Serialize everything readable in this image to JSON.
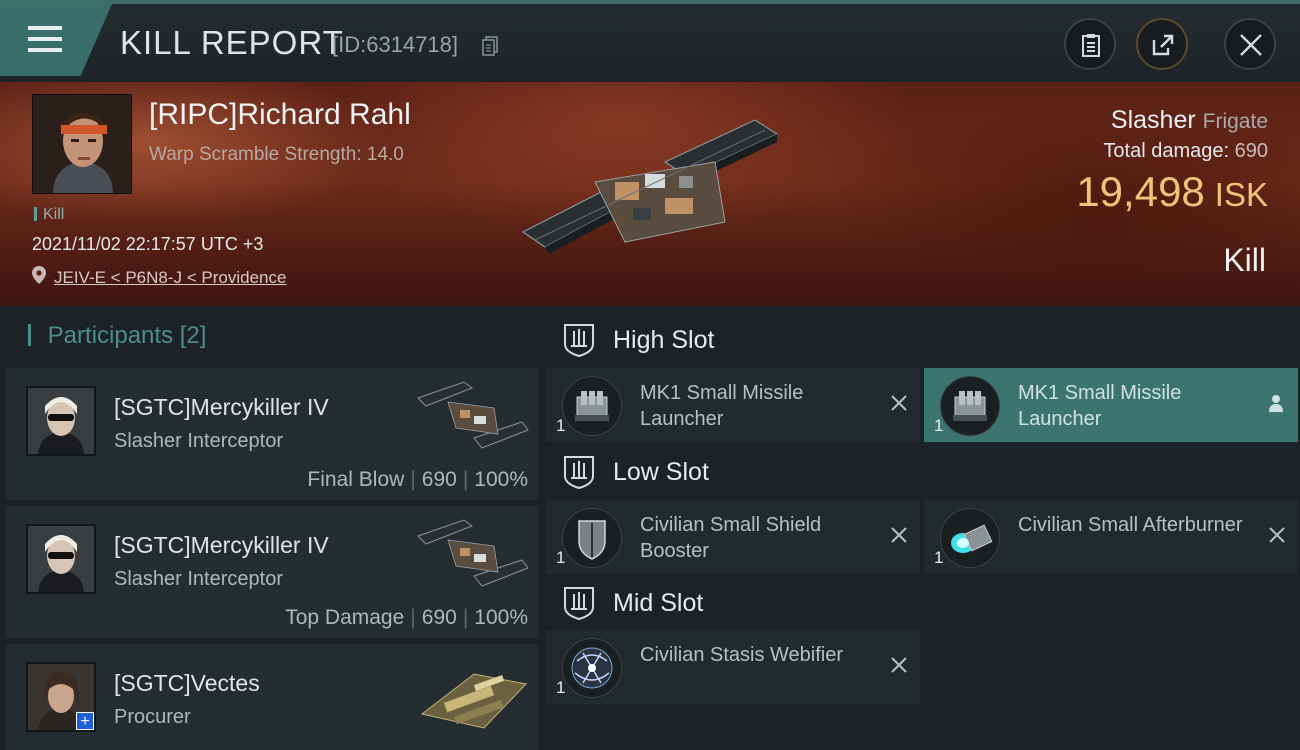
{
  "header": {
    "title": "KILL REPORT",
    "report_id": "[ID:6314718]",
    "icons": {
      "menu": "hamburger-icon",
      "copy": "copy-icon",
      "clipboard": "clipboard-icon",
      "share": "share-icon",
      "close": "close-icon"
    }
  },
  "victim": {
    "name": "[RIPC]Richard Rahl",
    "warp_scramble": "Warp Scramble Strength: 14.0",
    "kill_tag": "Kill",
    "datetime": "2021/11/02 22:17:57 UTC +3",
    "location": "JEIV-E < P6N8-J < Providence",
    "ship_name": "Slasher",
    "ship_class": "Frigate",
    "total_damage_label": "Total damage:",
    "total_damage_value": "690",
    "isk_value": "19,498",
    "isk_unit": "ISK",
    "kill_type": "Kill"
  },
  "participants": {
    "title": "Participants",
    "count": "[2]",
    "items": [
      {
        "name": "[SGTC]Mercykiller IV",
        "ship": "Slasher Interceptor",
        "role": "Final Blow",
        "damage": "690",
        "percent": "100%"
      },
      {
        "name": "[SGTC]Mercykiller IV",
        "ship": "Slasher Interceptor",
        "role": "Top Damage",
        "damage": "690",
        "percent": "100%"
      },
      {
        "name": "[SGTC]Vectes",
        "ship": "Procurer"
      }
    ]
  },
  "fitting": {
    "high_slot": {
      "label": "High Slot",
      "modules": [
        {
          "name": "MK1 Small Missile Launcher",
          "qty": "1",
          "icon": "missile-launcher-icon"
        },
        {
          "name": "MK1 Small Missile Launcher",
          "qty": "1",
          "icon": "missile-launcher-icon"
        }
      ]
    },
    "low_slot": {
      "label": "Low Slot",
      "modules": [
        {
          "name": "Civilian Small Shield Booster",
          "qty": "1",
          "icon": "shield-booster-icon"
        },
        {
          "name": "Civilian Small Afterburner",
          "qty": "1",
          "icon": "afterburner-icon"
        }
      ]
    },
    "mid_slot": {
      "label": "Mid Slot",
      "modules": [
        {
          "name": "Civilian Stasis Webifier",
          "qty": "1",
          "icon": "stasis-webifier-icon"
        }
      ]
    }
  },
  "colors": {
    "accent": "#3a6e6a",
    "isk": "#f0c27a",
    "banner": "#5a2016"
  }
}
